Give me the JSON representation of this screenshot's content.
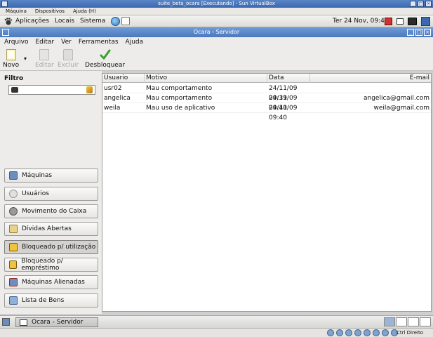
{
  "vbox": {
    "title": "suite_beta_ocara [Executando] - Sun VirtualBox",
    "menu": [
      "Máquina",
      "Dispositivos",
      "Ajuda (H)"
    ],
    "status_hostkey": "Ctrl Direito"
  },
  "gnome_panel": {
    "menu": [
      "Aplicações",
      "Locais",
      "Sistema"
    ],
    "clock": "Ter 24 Nov, 09:40"
  },
  "app": {
    "title": "Ocara - Servidor",
    "menu": [
      "Arquivo",
      "Editar",
      "Ver",
      "Ferramentas",
      "Ajuda"
    ],
    "toolbar": {
      "novo": "Novo",
      "editar": "Editar",
      "excluir": "Excluir",
      "desbloquear": "Desbloquear"
    },
    "filter": {
      "label": "Filtro",
      "value": ""
    },
    "nav": [
      {
        "label": "Máquinas",
        "icon": "computer-icon"
      },
      {
        "label": "Usuários",
        "icon": "users-icon"
      },
      {
        "label": "Movimento do Caixa",
        "icon": "coins-icon"
      },
      {
        "label": "Dívidas Abertas",
        "icon": "folder-icon"
      },
      {
        "label": "Bloqueado p/ utilização",
        "icon": "lock-icon"
      },
      {
        "label": "Bloqueado p/ empréstimo",
        "icon": "lock-icon"
      },
      {
        "label": "Máquinas Alienadas",
        "icon": "computer-warning-icon"
      },
      {
        "label": "Lista de Bens",
        "icon": "list-icon"
      }
    ],
    "active_nav": "Bloqueado p/ utilização",
    "table": {
      "columns": [
        "Usuario",
        "Motivo",
        "Data",
        "E-mail"
      ],
      "rows": [
        {
          "usuario": "usr02",
          "motivo": "Mau comportamento",
          "data": "24/11/09 09:39",
          "email": ""
        },
        {
          "usuario": "angelica",
          "motivo": "Mau comportamento",
          "data": "24/11/09 09:40",
          "email": "angelica@gmail.com"
        },
        {
          "usuario": "weila",
          "motivo": "Mau uso de aplicativo",
          "data": "24/11/09 09:40",
          "email": "weila@gmail.com"
        }
      ]
    }
  },
  "taskbar": {
    "task": "Ocara - Servidor"
  }
}
